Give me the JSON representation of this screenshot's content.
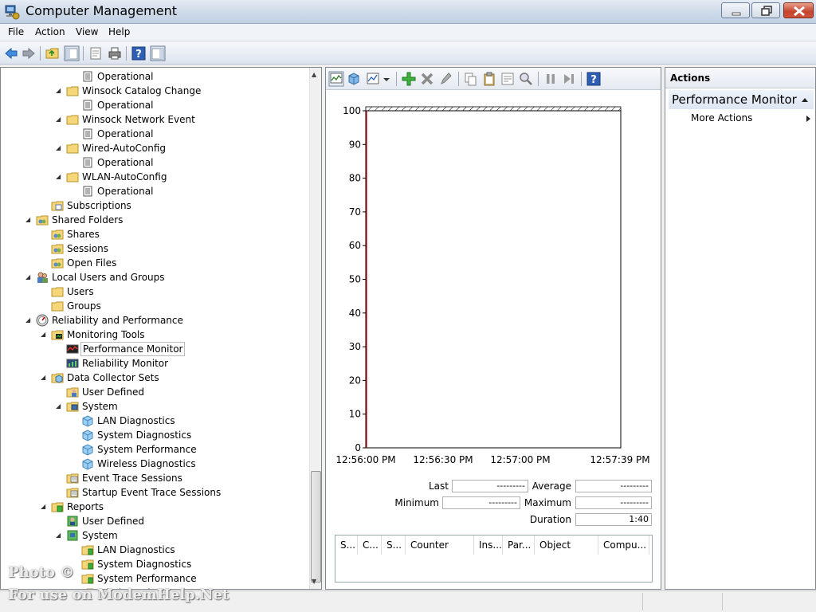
{
  "window": {
    "title": "Computer Management"
  },
  "menu": [
    "File",
    "Action",
    "View",
    "Help"
  ],
  "tree": [
    {
      "label": "Operational",
      "icon": "log-icon",
      "indent": 3,
      "twisty": ""
    },
    {
      "label": "Winsock Catalog Change",
      "icon": "folder-icon",
      "indent": 2,
      "twisty": "open"
    },
    {
      "label": "Operational",
      "icon": "log-icon",
      "indent": 3,
      "twisty": ""
    },
    {
      "label": "Winsock Network Event",
      "icon": "folder-icon",
      "indent": 2,
      "twisty": "open"
    },
    {
      "label": "Operational",
      "icon": "log-icon",
      "indent": 3,
      "twisty": ""
    },
    {
      "label": "Wired-AutoConfig",
      "icon": "folder-icon",
      "indent": 2,
      "twisty": "open"
    },
    {
      "label": "Operational",
      "icon": "log-icon",
      "indent": 3,
      "twisty": ""
    },
    {
      "label": "WLAN-AutoConfig",
      "icon": "folder-icon",
      "indent": 2,
      "twisty": "open"
    },
    {
      "label": "Operational",
      "icon": "log-icon",
      "indent": 3,
      "twisty": ""
    },
    {
      "label": "Subscriptions",
      "icon": "subscriptions-icon",
      "indent": 1,
      "twisty": ""
    },
    {
      "label": "Shared Folders",
      "icon": "shared-folder-icon",
      "indent": 0,
      "twisty": "open"
    },
    {
      "label": "Shares",
      "icon": "shared-folder-icon",
      "indent": 1,
      "twisty": ""
    },
    {
      "label": "Sessions",
      "icon": "shared-folder-icon",
      "indent": 1,
      "twisty": ""
    },
    {
      "label": "Open Files",
      "icon": "shared-folder-icon",
      "indent": 1,
      "twisty": ""
    },
    {
      "label": "Local Users and Groups",
      "icon": "users-groups-icon",
      "indent": 0,
      "twisty": "open"
    },
    {
      "label": "Users",
      "icon": "folder-icon",
      "indent": 1,
      "twisty": ""
    },
    {
      "label": "Groups",
      "icon": "folder-icon",
      "indent": 1,
      "twisty": ""
    },
    {
      "label": "Reliability and Performance",
      "icon": "gauge-icon",
      "indent": 0,
      "twisty": "open"
    },
    {
      "label": "Monitoring Tools",
      "icon": "monitor-folder-icon",
      "indent": 1,
      "twisty": "open"
    },
    {
      "label": "Performance Monitor",
      "icon": "perfmon-icon",
      "indent": 2,
      "twisty": "",
      "selected": true
    },
    {
      "label": "Reliability Monitor",
      "icon": "relmon-icon",
      "indent": 2,
      "twisty": ""
    },
    {
      "label": "Data Collector Sets",
      "icon": "dcs-folder-icon",
      "indent": 1,
      "twisty": "open"
    },
    {
      "label": "User Defined",
      "icon": "user-folder-icon",
      "indent": 2,
      "twisty": ""
    },
    {
      "label": "System",
      "icon": "system-folder-icon",
      "indent": 2,
      "twisty": "open"
    },
    {
      "label": "LAN Diagnostics",
      "icon": "dcs-item-icon",
      "indent": 3,
      "twisty": ""
    },
    {
      "label": "System Diagnostics",
      "icon": "dcs-item-icon",
      "indent": 3,
      "twisty": ""
    },
    {
      "label": "System Performance",
      "icon": "dcs-item-icon",
      "indent": 3,
      "twisty": ""
    },
    {
      "label": "Wireless Diagnostics",
      "icon": "dcs-item-icon",
      "indent": 3,
      "twisty": ""
    },
    {
      "label": "Event Trace Sessions",
      "icon": "trace-folder-icon",
      "indent": 2,
      "twisty": ""
    },
    {
      "label": "Startup Event Trace Sessions",
      "icon": "trace-folder-icon",
      "indent": 2,
      "twisty": ""
    },
    {
      "label": "Reports",
      "icon": "reports-folder-icon",
      "indent": 1,
      "twisty": "open"
    },
    {
      "label": "User Defined",
      "icon": "report-user-icon",
      "indent": 2,
      "twisty": ""
    },
    {
      "label": "System",
      "icon": "report-system-icon",
      "indent": 2,
      "twisty": "open"
    },
    {
      "label": "LAN Diagnostics",
      "icon": "report-folder-icon",
      "indent": 3,
      "twisty": ""
    },
    {
      "label": "System Diagnostics",
      "icon": "report-folder-icon",
      "indent": 3,
      "twisty": ""
    },
    {
      "label": "System Performance",
      "icon": "report-folder-icon",
      "indent": 3,
      "twisty": ""
    },
    {
      "label": "Wireless Diagnostics",
      "icon": "report-folder-icon",
      "indent": 3,
      "twisty": ""
    }
  ],
  "chart_data": {
    "type": "line",
    "title": "",
    "xlabel": "",
    "ylabel": "",
    "ylim": [
      0,
      100
    ],
    "yticks": [
      0,
      10,
      20,
      30,
      40,
      50,
      60,
      70,
      80,
      90,
      100
    ],
    "xticks": [
      "12:56:00 PM",
      "12:56:30 PM",
      "12:57:00 PM",
      "12:57:39 PM"
    ],
    "grid": false,
    "series": []
  },
  "stats": {
    "last_label": "Last",
    "last_value": "---------",
    "average_label": "Average",
    "average_value": "---------",
    "minimum_label": "Minimum",
    "minimum_value": "---------",
    "maximum_label": "Maximum",
    "maximum_value": "---------",
    "duration_label": "Duration",
    "duration_value": "1:40"
  },
  "counter_columns": [
    "S...",
    "C...",
    "S...",
    "Counter",
    "Ins...",
    "Par...",
    "Object",
    "Compu..."
  ],
  "actions": {
    "header": "Actions",
    "section": "Performance Monitor",
    "item": "More Actions"
  },
  "watermark": {
    "line1": "Photo ©",
    "line2": "For use on ModemHelp.Net"
  },
  "colors": {
    "accent": "#316ac5",
    "timebar": "#cc0000"
  }
}
